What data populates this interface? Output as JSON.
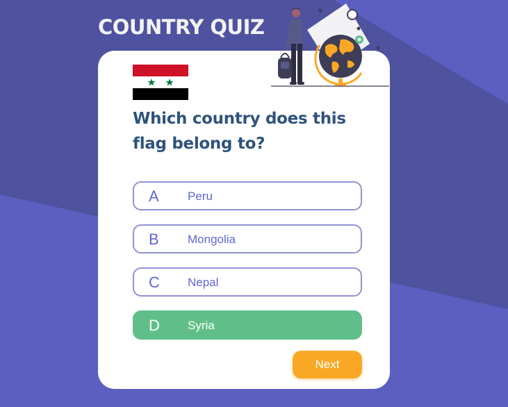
{
  "app": {
    "title": "COUNTRY QUIZ"
  },
  "quiz": {
    "question": "Which country does this flag belong to?",
    "flag_icon": "syria-flag-icon",
    "options": [
      {
        "letter": "A",
        "label": "Peru",
        "state": "default"
      },
      {
        "letter": "B",
        "label": "Mongolia",
        "state": "default"
      },
      {
        "letter": "C",
        "label": "Nepal",
        "state": "default"
      },
      {
        "letter": "D",
        "label": "Syria",
        "state": "correct"
      }
    ],
    "next_label": "Next"
  },
  "colors": {
    "background": "#5a5fc0",
    "background_dark": "#4e529f",
    "card": "#ffffff",
    "question_text": "#2f527b",
    "option_border": "#9091d4",
    "option_text": "#6066d0",
    "correct": "#60bf88",
    "next_button": "#f9a826"
  }
}
